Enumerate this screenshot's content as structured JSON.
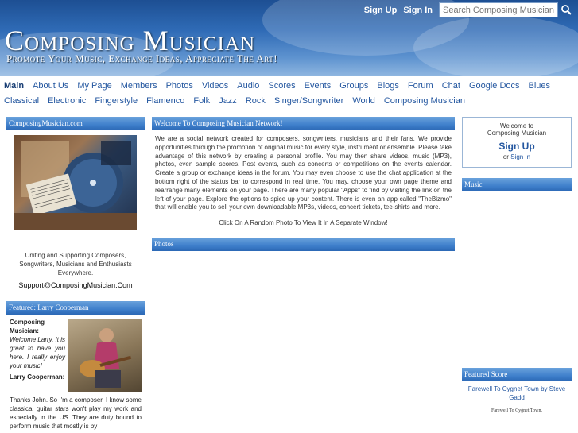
{
  "header": {
    "title": "Composing Musician",
    "tagline": "Promote Your Music, Exchange Ideas, Appreciate The Art!",
    "signup_label": "Sign Up",
    "signin_label": "Sign In",
    "search_placeholder": "Search Composing Musician"
  },
  "nav": {
    "row1": [
      "Main",
      "About Us",
      "My Page",
      "Members",
      "Photos",
      "Videos",
      "Audio",
      "Scores",
      "Events",
      "Groups",
      "Blogs",
      "Forum",
      "Chat",
      "Google Docs",
      "Blues"
    ],
    "row2": [
      "Classical",
      "Electronic",
      "Fingerstyle",
      "Flamenco",
      "Folk",
      "Jazz",
      "Rock",
      "Singer/Songwriter",
      "World",
      "Composing Musician"
    ]
  },
  "left": {
    "site_box_title": "ComposingMusician.com",
    "site_desc": "Uniting and Supporting Composers, Songwriters, Musicians and Enthusiasts Everywhere.",
    "support_email": "Support@ComposingMusician.Com",
    "featured_title": "Featured: Larry Cooperman",
    "featured_name1": "Composing Musician:",
    "featured_msg1": "Welcome Larry, It is great to have you here. I really enjoy your music!",
    "featured_name2": "Larry Cooperman:",
    "featured_msg2": "Thanks John. So I'm a composer. I know some classical guitar stars won't play my work and especially in the US. They are duty bound to perform music that mostly is by"
  },
  "mid": {
    "welcome_title": "Welcome To Composing Musician Network!",
    "welcome_body": "We are a social network created for composers, songwriters, musicians and their fans. We provide opportunities through the promotion of original music for every style, instrument or ensemble. Please take advantage of this network by creating a personal profile. You may then share videos, music (MP3), photos, even sample scores. Post events, such as concerts or competitions on the events calendar. Create a group or exchange ideas in the forum. You may even choose to use the chat application at the bottom right of the status bar to correspond in real time. You may, choose your own page theme and rearrange many elements on your page. There are many popular \"Apps\" to find by visiting the link on the left of your page. Explore the options to spice up your content. There is even an app called \"TheBizmo\" that will enable you to sell your own downloadable MP3s, videos, concert tickets, tee-shirts and more.",
    "random_photo": "Click On A Random Photo To View It In A Separate Window!",
    "photos_title": "Photos"
  },
  "right": {
    "welcome_to": "Welcome to",
    "site_name": "Composing Musician",
    "signup_label": "Sign Up",
    "or_label": "or",
    "signin_label": "Sign In",
    "music_title": "Music",
    "featured_score_title": "Featured Score",
    "featured_score_link": "Farewell To Cygnet Town by Steve Gadd",
    "score_caption": "Farewell To Cygnet Town."
  },
  "colors": {
    "link": "#2457a0",
    "header_top": "#1d4f93",
    "box_head": "#3f7fcb"
  }
}
